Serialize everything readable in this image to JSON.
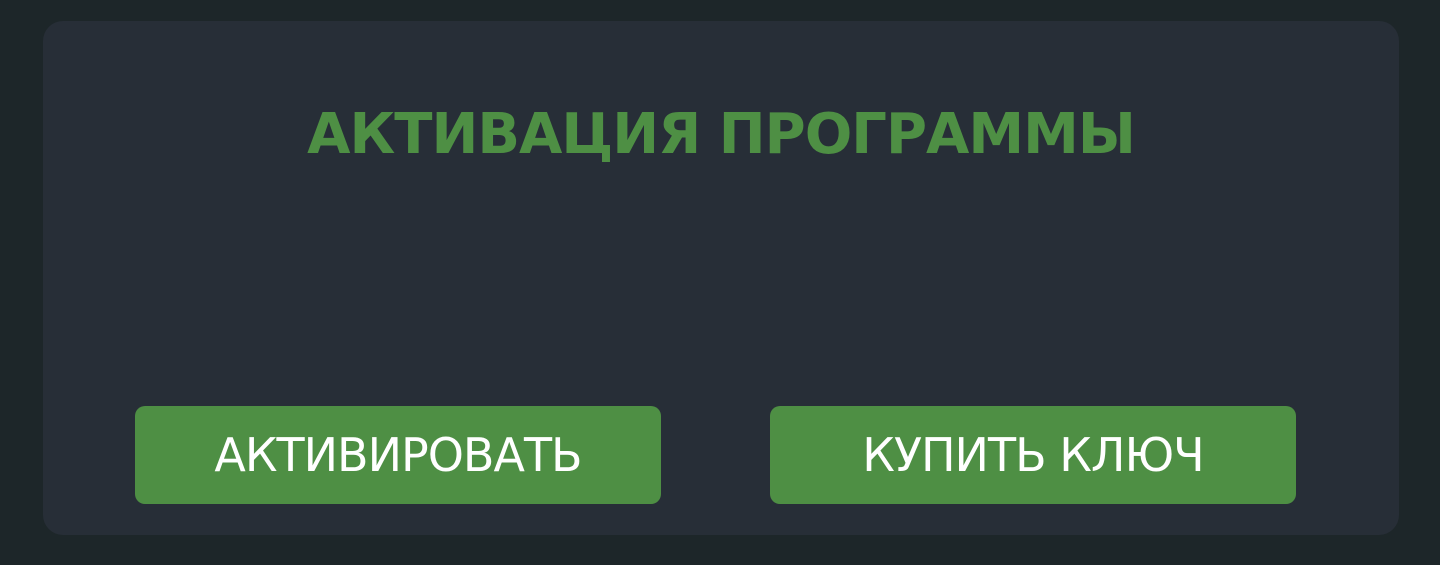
{
  "dialog": {
    "title": "АКТИВАЦИЯ ПРОГРАММЫ",
    "activate_label": "АКТИВИРОВАТЬ",
    "buy_key_label": "КУПИТЬ КЛЮЧ"
  },
  "colors": {
    "background": "#1d2629",
    "panel": "#272e37",
    "accent": "#4e8f44",
    "button_text": "#ffffff"
  }
}
